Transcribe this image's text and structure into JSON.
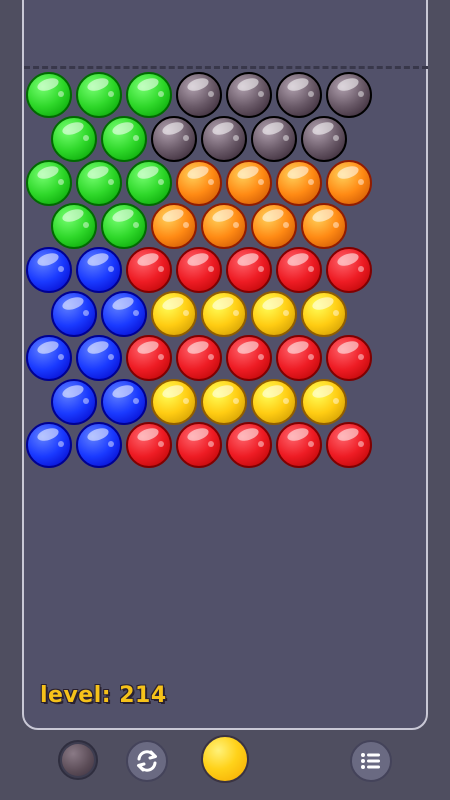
{
  "level": {
    "text": "level: 214"
  },
  "colors": {
    "green": "#2fd82a",
    "gray": "#6a5a68",
    "orange": "#ff8a14",
    "blue": "#1a3aff",
    "red": "#ee1c24",
    "yellow": "#ffcc12",
    "accent_text": "#f6c21a",
    "background": "#4f4e60"
  },
  "bubble_rows": [
    [
      "green",
      "green",
      "green",
      "gray",
      "gray",
      "gray",
      "gray"
    ],
    [
      "green",
      "green",
      "gray",
      "gray",
      "gray",
      "gray"
    ],
    [
      "green",
      "green",
      "green",
      "orange",
      "orange",
      "orange",
      "orange"
    ],
    [
      "green",
      "green",
      "orange",
      "orange",
      "orange",
      "orange"
    ],
    [
      "blue",
      "blue",
      "red",
      "red",
      "red",
      "red",
      "red"
    ],
    [
      "blue",
      "blue",
      "yellow",
      "yellow",
      "yellow",
      "yellow"
    ],
    [
      "blue",
      "blue",
      "red",
      "red",
      "red",
      "red",
      "red"
    ],
    [
      "blue",
      "blue",
      "yellow",
      "yellow",
      "yellow",
      "yellow"
    ],
    [
      "blue",
      "blue",
      "red",
      "red",
      "red",
      "red",
      "red"
    ]
  ],
  "toolbar": {
    "next_bubble_color": "gray",
    "current_bubble_color": "yellow",
    "refresh_icon": "refresh-icon",
    "menu_icon": "list-menu-icon"
  }
}
